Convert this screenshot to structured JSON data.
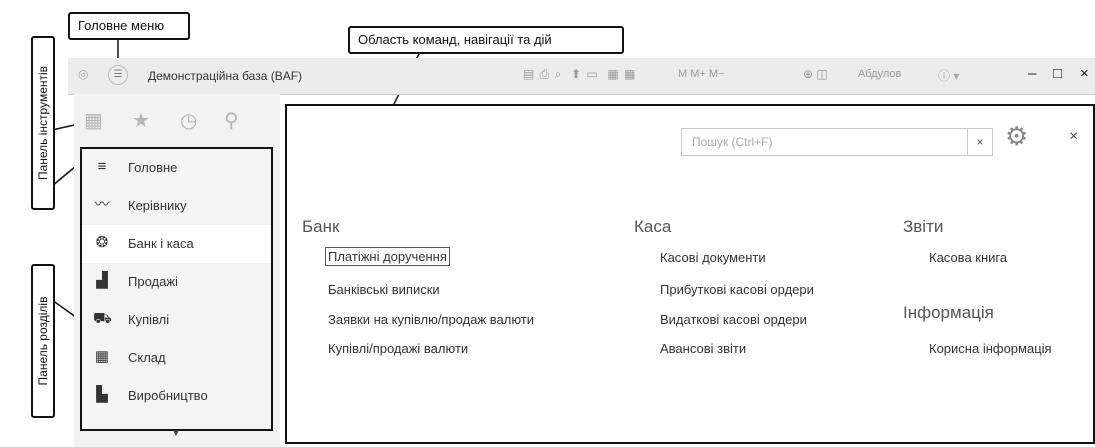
{
  "annotations": {
    "main_menu": "Головне меню",
    "command_area": "Область команд, навігації та дій",
    "tools_panel": "Панель інструментів",
    "sections_panel": "Панель розділів"
  },
  "window": {
    "title": "Демонстраційна база  (BAF)",
    "toolbar_text": "M  M+  M−",
    "user": "Абдулов"
  },
  "sections": [
    {
      "label": "Головне",
      "icon": "menu-lines-icon"
    },
    {
      "label": "Керівнику",
      "icon": "trend-icon"
    },
    {
      "label": "Банк і каса",
      "icon": "coin-icon"
    },
    {
      "label": "Продажі",
      "icon": "bag-icon"
    },
    {
      "label": "Купівлі",
      "icon": "cart-icon"
    },
    {
      "label": "Склад",
      "icon": "warehouse-icon"
    },
    {
      "label": "Виробництво",
      "icon": "factory-icon"
    }
  ],
  "search": {
    "placeholder": "Пошук (Ctrl+F)"
  },
  "groups": {
    "bank": {
      "title": "Банк",
      "items": [
        "Платіжні доручення",
        "Банківські виписки",
        "Заявки на купівлю/продаж валюти",
        "Купівлі/продажі валюти"
      ]
    },
    "kasa": {
      "title": "Каса",
      "items": [
        "Касові документи",
        "Прибуткові касові ордери",
        "Видаткові касові ордери",
        "Авансові звіти"
      ]
    },
    "reports": {
      "title": "Звіти",
      "items": [
        "Касова книга"
      ]
    },
    "info": {
      "title": "Інформація",
      "items": [
        "Корисна інформація"
      ]
    }
  }
}
